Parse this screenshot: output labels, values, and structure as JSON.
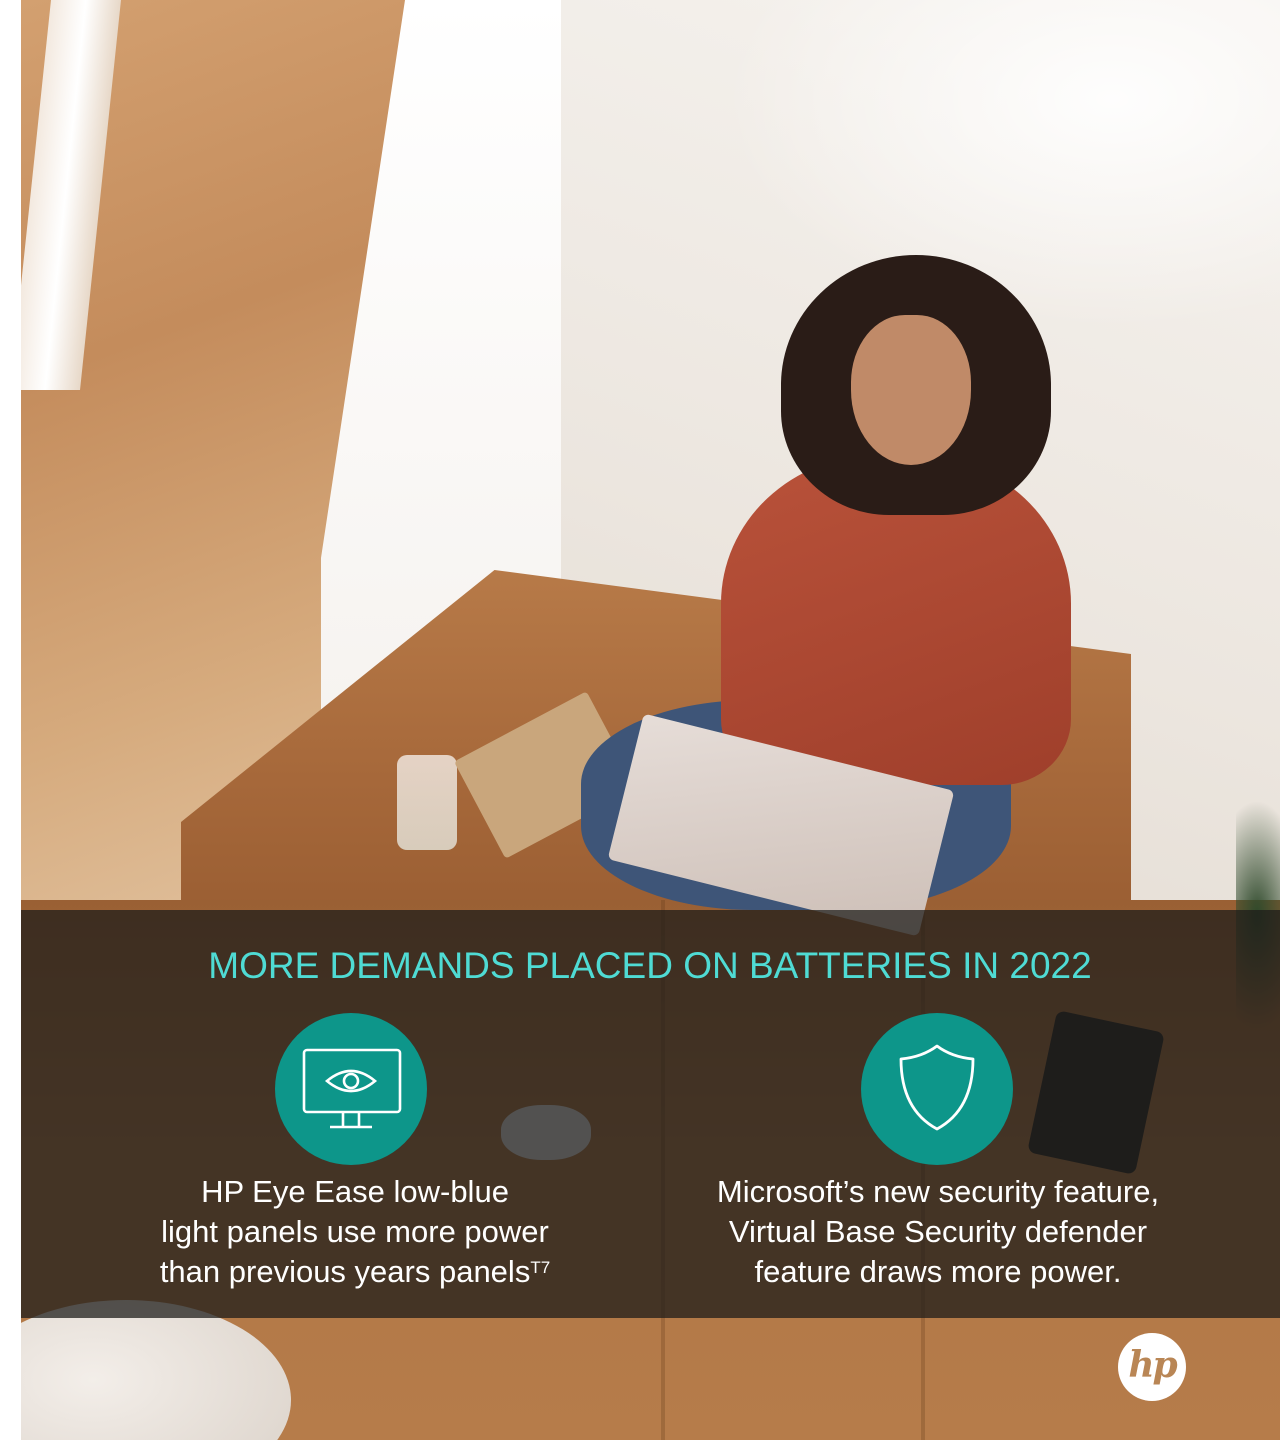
{
  "headline": "MORE DEMANDS PLACED ON BATTERIES IN 2022",
  "features": [
    {
      "icon": "monitor-eye-icon",
      "lines": [
        "HP Eye Ease low-blue",
        "light panels use more power",
        "than previous years panels"
      ],
      "footnote": "T7"
    },
    {
      "icon": "shield-icon",
      "lines": [
        "Microsoft’s new security feature,",
        "Virtual Base Security defender",
        "feature draws more power."
      ]
    }
  ],
  "logo": {
    "text": "hp"
  },
  "colors": {
    "accent_text": "#4fdbd4",
    "icon_circle": "#0d968a",
    "band": "rgba(30,28,26,0.74)"
  }
}
